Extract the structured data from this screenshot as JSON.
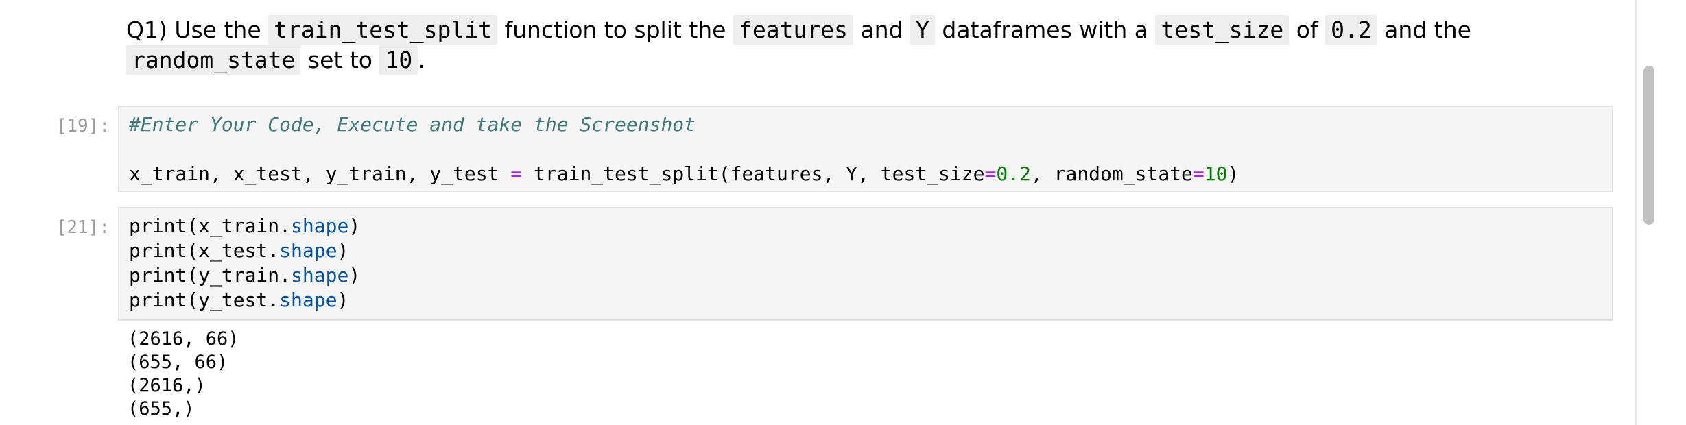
{
  "markdown": {
    "q_prefix": "Q1) Use the ",
    "code_fn": "train_test_split",
    "t2": " function to split the ",
    "code_features": "features",
    "t3": " and ",
    "code_y": "Y",
    "t4": " dataframes with a ",
    "code_test_size": "test_size",
    "t5": " of ",
    "code_value": "0.2",
    "t6": " and the",
    "code_random_state": "random_state",
    "t7": " set to ",
    "code_ten": "10",
    "t8": "."
  },
  "cell1": {
    "prompt": "[19]:",
    "comment": "#Enter Your Code, Execute and take the Screenshot",
    "line2_a": "x_train, x_test, y_train, y_test ",
    "line2_eq1": "=",
    "line2_b": " train_test_split(features, Y, test_size",
    "line2_eq2": "=",
    "line2_num1": "0.2",
    "line2_c": ", random_state",
    "line2_eq3": "=",
    "line2_num2": "10",
    "line2_d": ")"
  },
  "cell2": {
    "prompt": "[21]:",
    "lines": [
      {
        "pre": "print(x_train.",
        "attr": "shape",
        "post": ")"
      },
      {
        "pre": "print(x_test.",
        "attr": "shape",
        "post": ")"
      },
      {
        "pre": "print(y_train.",
        "attr": "shape",
        "post": ")"
      },
      {
        "pre": "print(y_test.",
        "attr": "shape",
        "post": ")"
      }
    ],
    "output": [
      "(2616, 66)",
      "(655, 66)",
      "(2616,)",
      "(655,)"
    ]
  },
  "colors": {
    "comment": "#3d7a7a",
    "operator": "#aa22ff",
    "number": "#008000",
    "attribute": "#0055aa",
    "prompt": "#9e9e9e",
    "cell_bg": "#f5f5f5"
  }
}
